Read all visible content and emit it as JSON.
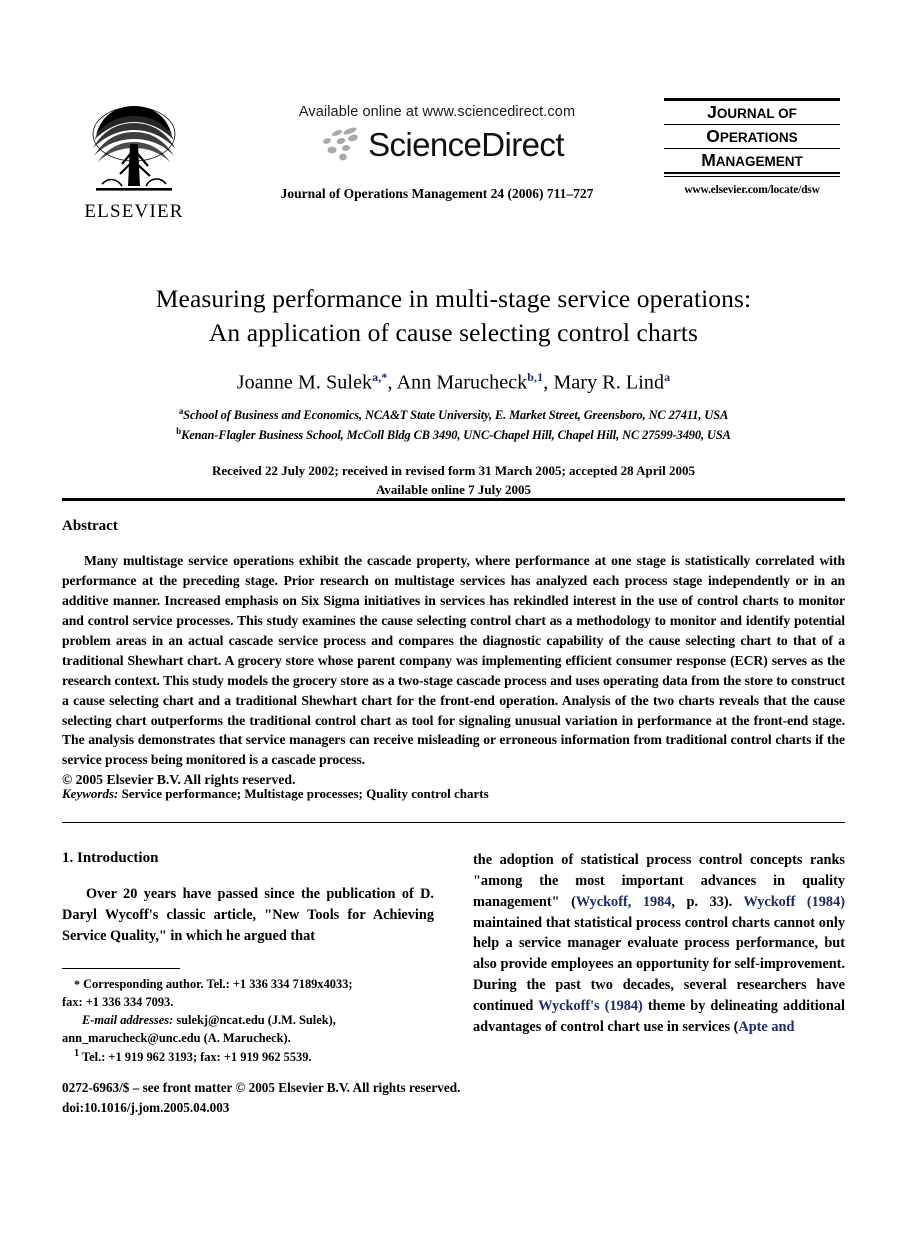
{
  "header": {
    "publisher_name": "ELSEVIER",
    "publisher_logo_icon": "elsevier-tree-icon",
    "available_online": "Available online at www.sciencedirect.com",
    "sciencedirect_wordmark": "ScienceDirect",
    "sciencedirect_logo_icon": "sciencedirect-swoosh-icon",
    "journal_reference": "Journal of Operations Management 24 (2006) 711–727",
    "journal_logo": {
      "line1": "Journal of",
      "line2": "Operations",
      "line3": "Management",
      "url": "www.elsevier.com/locate/dsw"
    }
  },
  "title": {
    "line1": "Measuring performance in multi-stage service operations:",
    "line2": "An application of cause selecting control charts"
  },
  "authors": [
    {
      "name": "Joanne M. Sulek",
      "marks": "a,*"
    },
    {
      "name": "Ann Marucheck",
      "marks": "b,1"
    },
    {
      "name": "Mary R. Lind",
      "marks": "a"
    }
  ],
  "affiliations": [
    {
      "mark": "a",
      "text": "School of Business and Economics, NCA&T State University, E. Market Street, Greensboro, NC 27411, USA"
    },
    {
      "mark": "b",
      "text": "Kenan-Flagler Business School, McColl Bldg CB 3490, UNC-Chapel Hill, Chapel Hill, NC 27599-3490, USA"
    }
  ],
  "dates": {
    "line1": "Received 22 July 2002; received in revised form 31 March 2005; accepted 28 April 2005",
    "line2": "Available online 7 July 2005"
  },
  "abstract": {
    "heading": "Abstract",
    "body": "Many multistage service operations exhibit the cascade property, where performance at one stage is statistically correlated with performance at the preceding stage. Prior research on multistage services has analyzed each process stage independently or in an additive manner. Increased emphasis on Six Sigma initiatives in services has rekindled interest in the use of control charts to monitor and control service processes. This study examines the cause selecting control chart as a methodology to monitor and identify potential problem areas in an actual cascade service process and compares the diagnostic capability of the cause selecting chart to that of a traditional Shewhart chart. A grocery store whose parent company was implementing efficient consumer response (ECR) serves as the research context. This study models the grocery store as a two-stage cascade process and uses operating data from the store to construct a cause selecting chart and a traditional Shewhart chart for the front-end operation. Analysis of the two charts reveals that the cause selecting chart outperforms the traditional control chart as tool for signaling unusual variation in performance at the front-end stage. The analysis demonstrates that service managers can receive misleading or erroneous information from traditional control charts if the service process being monitored is a cascade process.",
    "copyright": "© 2005 Elsevier B.V. All rights reserved."
  },
  "keywords": {
    "label": "Keywords:",
    "value": "Service performance; Multistage processes; Quality control charts"
  },
  "body": {
    "section_heading": "1. Introduction",
    "left_paragraph": "Over 20 years have passed since the publication of D. Daryl Wycoff's classic article, \"New Tools for Achieving Service Quality,\" in which he argued that",
    "right_paragraph_1": "the adoption of statistical process control concepts ranks \"among the most important advances in quality management\" (",
    "right_cite_1": "Wyckoff, 1984",
    "right_paragraph_2": ", p. 33). ",
    "right_cite_2": "Wyckoff (1984)",
    "right_paragraph_3": " maintained that statistical process control charts cannot only help a service manager evaluate process performance, but also provide employees an opportunity for self-improvement. During the past two decades, several researchers have continued ",
    "right_cite_3": "Wyckoff's (1984)",
    "right_paragraph_4": " theme by delineating additional advantages of control chart use in services (",
    "right_cite_4": "Apte and"
  },
  "footnotes": {
    "corresponding_marker": "*",
    "corresponding": "Corresponding author. Tel.: +1 336 334 7189x4033;",
    "fax": "fax: +1 336 334 7093.",
    "email_label": "E-mail addresses:",
    "email_1": "sulekj@ncat.edu (J.M. Sulek),",
    "email_2": "ann_marucheck@unc.edu (A. Marucheck).",
    "note1_marker": "1",
    "note1": "Tel.: +1 919 962 3193; fax: +1 919 962 5539."
  },
  "footer": {
    "issn_line": "0272-6963/$ – see front matter © 2005 Elsevier B.V. All rights reserved.",
    "doi_line": "doi:10.1016/j.jom.2005.04.003"
  },
  "colors": {
    "citation_blue": "#1b2a6b",
    "text_black": "#000000",
    "page_background": "#ffffff"
  }
}
